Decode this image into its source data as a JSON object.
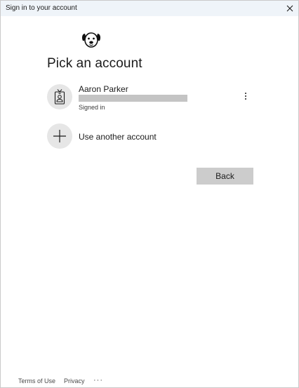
{
  "window": {
    "title": "Sign in to your account"
  },
  "heading": "Pick an account",
  "account": {
    "name": "Aaron Parker",
    "status": "Signed in"
  },
  "use_another": {
    "label": "Use another account"
  },
  "buttons": {
    "back": "Back"
  },
  "footer": {
    "terms": "Terms of Use",
    "privacy": "Privacy",
    "more": "···"
  },
  "icons": {
    "logo": "dog-face-icon",
    "avatar": "id-badge-icon",
    "more": "vertical-ellipsis-icon",
    "add": "plus-icon",
    "close": "close-icon"
  },
  "colors": {
    "titlebar": "#eff4f9",
    "avatar_bg": "#e6e6e6",
    "back_button": "#cccccc",
    "redacted": "#c4c4c4"
  }
}
